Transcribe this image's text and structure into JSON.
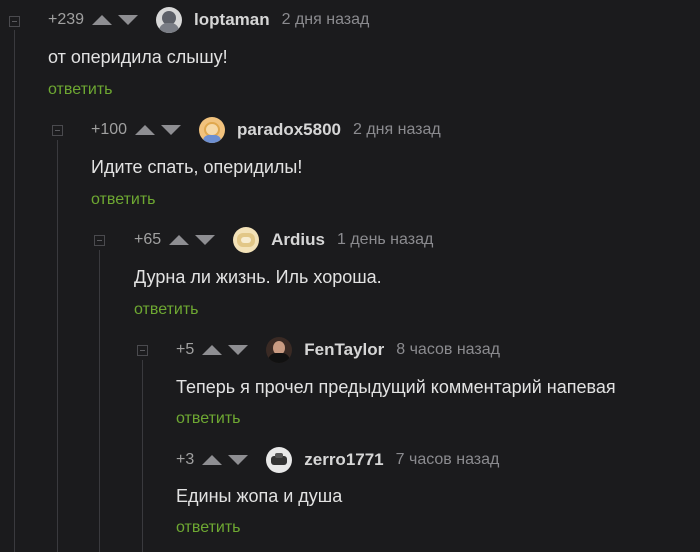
{
  "reply_label": "ответить",
  "comments": [
    {
      "rating": "+239",
      "username": "loptaman",
      "time": "2 дня назад",
      "text": "от оперидила слышу!",
      "avatar_icon": "user-avatar-icon"
    },
    {
      "rating": "+100",
      "username": "paradox5800",
      "time": "2 дня назад",
      "text": "Идите спать, оперидилы!",
      "avatar_icon": "user-avatar-icon"
    },
    {
      "rating": "+65",
      "username": "Ardius",
      "time": "1 день назад",
      "text": "Дурна ли жизнь. Иль хороша.",
      "avatar_icon": "user-avatar-icon"
    },
    {
      "rating": "+5",
      "username": "FenTaylor",
      "time": "8 часов назад",
      "text": "Теперь я прочел предыдущий комментарий напевая",
      "avatar_icon": "user-avatar-icon"
    },
    {
      "rating": "+3",
      "username": "zerro1771",
      "time": "7 часов назад",
      "text": "Едины жопа и душа",
      "avatar_icon": "user-avatar-icon"
    }
  ],
  "colors": {
    "background": "#1b1b1d",
    "reply_link": "#6ea832",
    "username": "#d6d6d6",
    "meta": "#8b8b8f"
  }
}
